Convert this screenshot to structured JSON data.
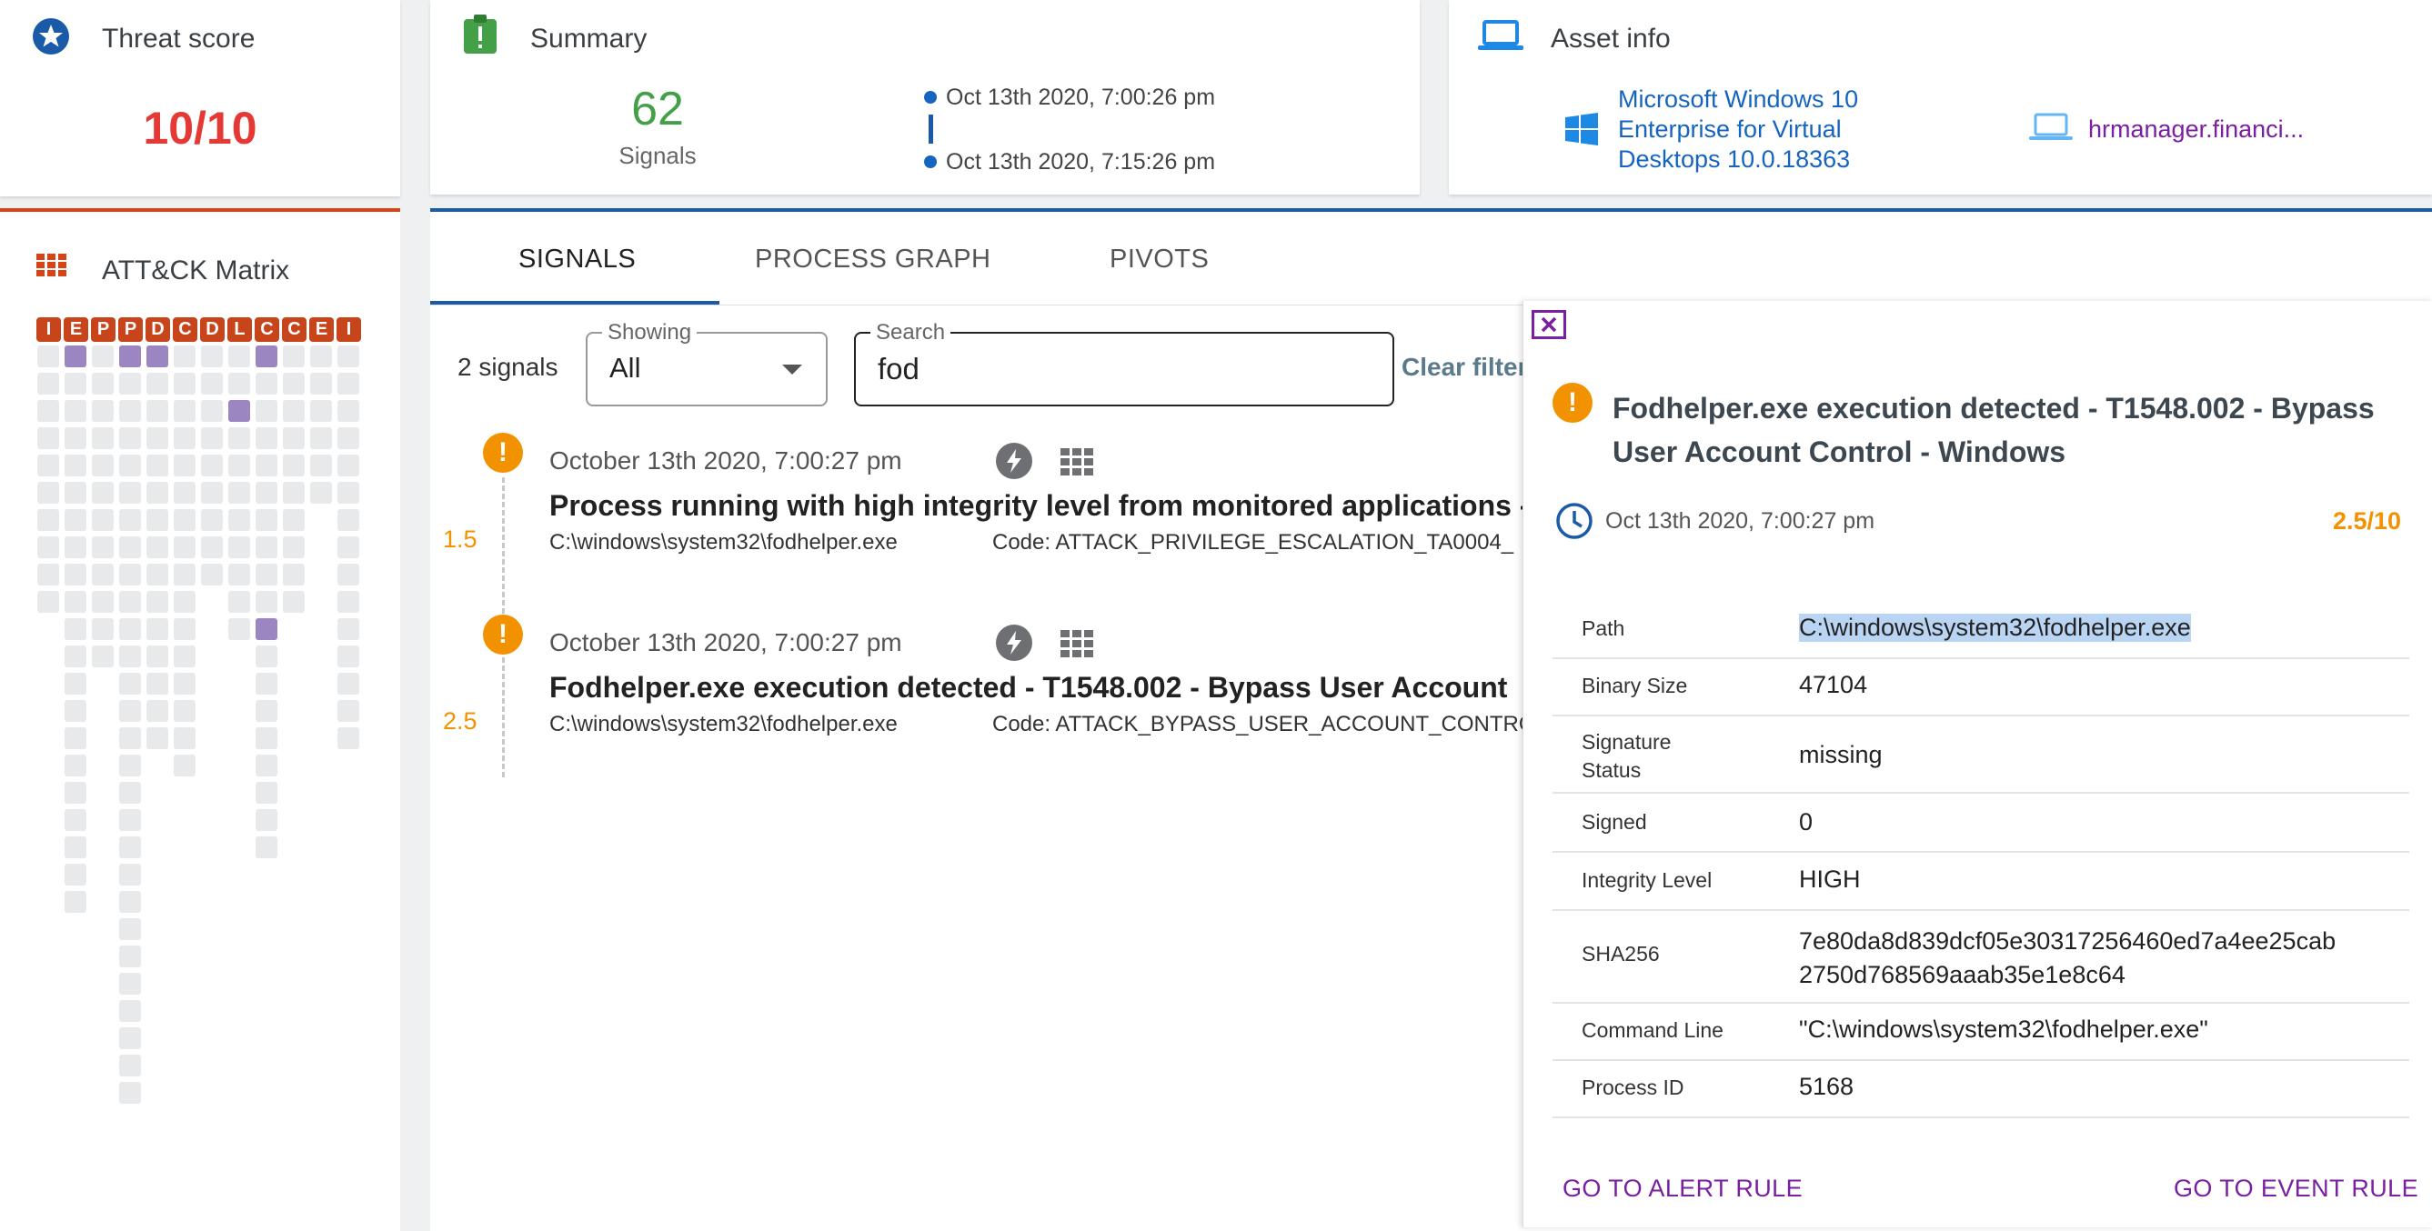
{
  "threat_card": {
    "title": "Threat score",
    "score": "10/10",
    "icon": "star-badge-icon"
  },
  "summary_card": {
    "title": "Summary",
    "signals_count": "62",
    "signals_label": "Signals",
    "timeline_start": "Oct 13th 2020, 7:00:26 pm",
    "timeline_end": "Oct 13th 2020, 7:15:26 pm",
    "icon": "clipboard-alert-icon"
  },
  "asset_card": {
    "title": "Asset info",
    "os_line1": "Microsoft Windows 10",
    "os_line2": "Enterprise for Virtual",
    "os_line3": "Desktops 10.0.18363",
    "hostname": "hrmanager.financi...",
    "icon": "laptop-icon"
  },
  "attack_matrix": {
    "title": "ATT&CK Matrix",
    "headers": [
      "I",
      "E",
      "P",
      "P",
      "D",
      "C",
      "D",
      "L",
      "C",
      "C",
      "E",
      "I"
    ],
    "column_lengths": [
      10,
      21,
      12,
      28,
      15,
      16,
      9,
      11,
      19,
      10,
      6,
      15
    ],
    "highlighted": [
      [
        1,
        0
      ],
      [
        3,
        0
      ],
      [
        4,
        0
      ],
      [
        8,
        0
      ],
      [
        7,
        2
      ],
      [
        8,
        10
      ]
    ],
    "colors": {
      "accent": "#d84315",
      "header": "#c8441b",
      "cell": "#e8e9eb",
      "hit": "#9c86c2"
    }
  },
  "tabs": {
    "signals": "SIGNALS",
    "process_graph": "PROCESS GRAPH",
    "pivots": "PIVOTS"
  },
  "filters": {
    "count_label": "2 signals",
    "showing_label": "Showing",
    "showing_value": "All",
    "search_label": "Search",
    "search_value": "fod",
    "clear_label": "Clear filter"
  },
  "signals": [
    {
      "date": "October 13th 2020, 7:00:27 pm",
      "title": "Process running with high integrity level from monitored applications -",
      "path": "C:\\windows\\system32\\fodhelper.exe",
      "code": "Code: ATTACK_PRIVILEGE_ESCALATION_TA0004_",
      "score": "1.5"
    },
    {
      "date": "October 13th 2020, 7:00:27 pm",
      "title": "Fodhelper.exe execution detected - T1548.002 - Bypass User Account",
      "path": "C:\\windows\\system32\\fodhelper.exe",
      "code": "Code: ATTACK_BYPASS_USER_ACCOUNT_CONTRO",
      "score": "2.5"
    }
  ],
  "detail": {
    "title_line1": "Fodhelper.exe execution detected - T1548.002 - Bypass",
    "title_line2": "User Account Control - Windows",
    "timestamp": "Oct 13th 2020, 7:00:27 pm",
    "score": "2.5/10",
    "rows": {
      "path_label": "Path",
      "path_value": "C:\\windows\\system32\\fodhelper.exe",
      "binary_size_label": "Binary Size",
      "binary_size_value": "47104",
      "signature_label_1": "Signature",
      "signature_label_2": "Status",
      "signature_value": "missing",
      "signed_label": "Signed",
      "signed_value": "0",
      "integrity_label": "Integrity Level",
      "integrity_value": "HIGH",
      "sha_label": "SHA256",
      "sha_value_1": "7e80da8d839dcf05e30317256460ed7a4ee25cab",
      "sha_value_2": "2750d768569aaab35e1e8c64",
      "cmd_label": "Command Line",
      "cmd_value": "\"C:\\windows\\system32\\fodhelper.exe\"",
      "pid_label": "Process ID",
      "pid_value": "5168"
    },
    "alert_rule_link": "GO TO ALERT RULE",
    "event_rule_link": "GO TO EVENT RULE"
  }
}
